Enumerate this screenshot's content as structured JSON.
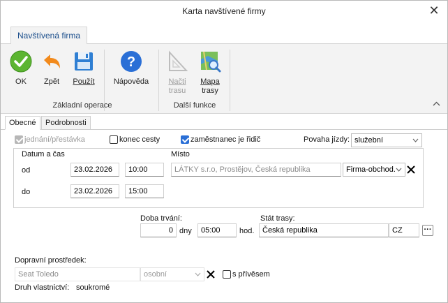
{
  "window": {
    "title": "Karta navštívené firmy",
    "close": "✕"
  },
  "ribbon": {
    "tab": "Navštívená firma",
    "buttons": {
      "ok": "OK",
      "back": "Zpět",
      "use": "Použít",
      "help": "Nápověda",
      "load_line1": "Načti",
      "load_line2": "trasu",
      "map_line1": "Mapa",
      "map_line2": "trasy"
    },
    "groups": {
      "basic": "Základní operace",
      "more": "Další funkce"
    },
    "collapse": "^",
    "colors": {
      "ok": "#5cb531",
      "back": "#f28a1c",
      "save": "#2f7fd3",
      "help": "#2a6fd6"
    }
  },
  "tabs": {
    "general": "Obecné",
    "details": "Podrobnosti"
  },
  "options": {
    "meeting": "jednání/přestávka",
    "end_trip": "konec cesty",
    "employee_driver": "zaměstnanec je řidič",
    "trip_type_label": "Povaha jízdy:",
    "trip_type_value": "služební"
  },
  "datetime": {
    "header_datetime": "Datum a čas",
    "header_place": "Místo",
    "from_label": "od",
    "to_label": "do",
    "from_date": "23.02.2026",
    "from_time": "10:00",
    "to_date": "23.02.2026",
    "to_time": "15:00",
    "place": "LÁTKY s.r.o, Prostějov, Česká republika",
    "place_type": "Firma-obchod."
  },
  "duration": {
    "label": "Doba trvání:",
    "days": "0",
    "days_unit": "dny",
    "hours": "05:00",
    "hours_unit": "hod.",
    "country_label": "Stát trasy:",
    "country": "Česká republika",
    "country_code": "CZ",
    "more": "···"
  },
  "transport": {
    "label": "Dopravní prostředek:",
    "vehicle": "Seat Toledo",
    "vehicle_type": "osobní",
    "trailer": "s přívěsem",
    "ownership_label": "Druh vlastnictví:",
    "ownership_value": "soukromé"
  }
}
